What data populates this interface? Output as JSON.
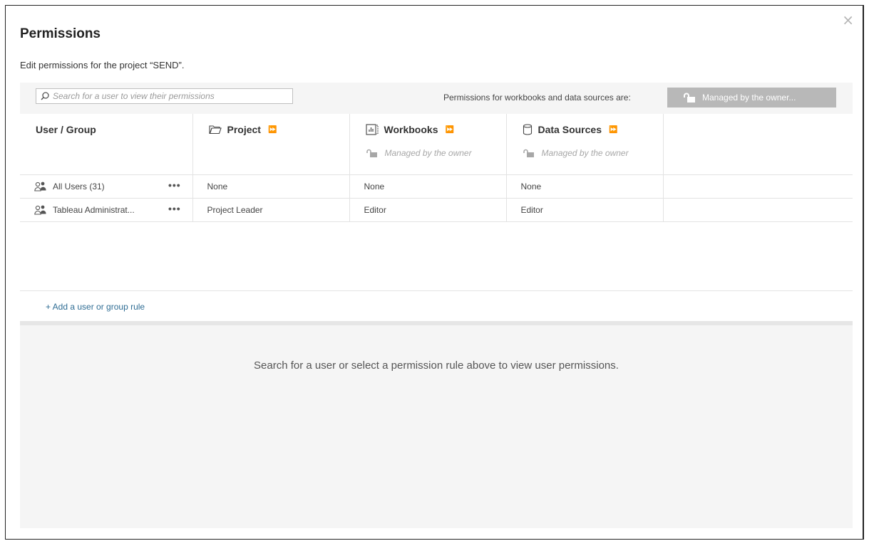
{
  "dialog": {
    "close_label": "×",
    "title": "Permissions",
    "subtitle": "Edit permissions for the project “SEND”."
  },
  "toolbar": {
    "search_placeholder": "Search for a user to view their permissions",
    "permissions_label": "Permissions for workbooks and data sources are:",
    "managed_button_label": "Managed by the owner..."
  },
  "table": {
    "headers": {
      "user_group": "User / Group",
      "project": "Project",
      "workbooks": "Workbooks",
      "data_sources": "Data Sources",
      "expand_glyph": "⏩"
    },
    "managed_note": "Managed by the owner",
    "rows": [
      {
        "name": "All Users (31)",
        "project": "None",
        "workbooks": "None",
        "data_sources": "None"
      },
      {
        "name": "Tableau Administrat...",
        "project": "Project Leader",
        "workbooks": "Editor",
        "data_sources": "Editor"
      }
    ],
    "more_label": "•••"
  },
  "add_rule_label": "+ Add a user or group rule",
  "bottom_message": "Search for a user or select a permission rule above to view user permissions.",
  "icons": [
    "close-icon",
    "search-icon",
    "unlock-icon",
    "folder-icon",
    "workbook-icon",
    "database-icon",
    "group-icon",
    "expand-icon",
    "more-icon"
  ],
  "colors": {
    "link": "#2f6d94",
    "button_bg": "#b8b8b8",
    "panel_bg": "#f5f5f5"
  }
}
